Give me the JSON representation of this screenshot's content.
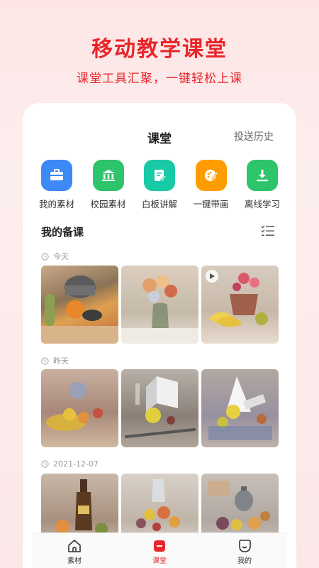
{
  "hero": {
    "title": "移动教学课堂",
    "subtitle": "课堂工具汇聚，一键轻松上课"
  },
  "card": {
    "title": "课堂",
    "history_label": "投送历史"
  },
  "tools": [
    {
      "label": "我的素材",
      "icon": "briefcase-icon",
      "color": "#3d8af7"
    },
    {
      "label": "校园素材",
      "icon": "school-icon",
      "color": "#2ec46b"
    },
    {
      "label": "白板讲解",
      "icon": "whiteboard-edit-icon",
      "color": "#18c9a6"
    },
    {
      "label": "一键带画",
      "icon": "palette-brush-icon",
      "color": "#ff9d00"
    },
    {
      "label": "离线学习",
      "icon": "download-icon",
      "color": "#2ec46b"
    }
  ],
  "section": {
    "title": "我的备课",
    "list_icon": "list-view-icon"
  },
  "groups": [
    {
      "date": "今天",
      "items": [
        {
          "name": "still-life-teapot-vegetables",
          "video": false
        },
        {
          "name": "still-life-flower-vase",
          "video": false
        },
        {
          "name": "still-life-flowers-bananas",
          "video": true
        }
      ]
    },
    {
      "date": "昨天",
      "items": [
        {
          "name": "still-life-fruit-plate",
          "video": false
        },
        {
          "name": "still-life-plaster-geometry",
          "video": false
        },
        {
          "name": "still-life-cone-fruit",
          "video": false
        }
      ]
    },
    {
      "date": "2021-12-07",
      "items": [
        {
          "name": "still-life-wine-bottle",
          "video": false
        },
        {
          "name": "still-life-glass-fruit",
          "video": false
        },
        {
          "name": "still-life-kettle-fruit",
          "video": false
        }
      ]
    }
  ],
  "tabbar": [
    {
      "label": "素材",
      "icon": "home-icon",
      "active": false
    },
    {
      "label": "课堂",
      "icon": "classroom-icon",
      "active": true
    },
    {
      "label": "我的",
      "icon": "smile-face-icon",
      "active": false
    }
  ],
  "colors": {
    "accent": "#e8262b",
    "background": "#fde8e8"
  }
}
